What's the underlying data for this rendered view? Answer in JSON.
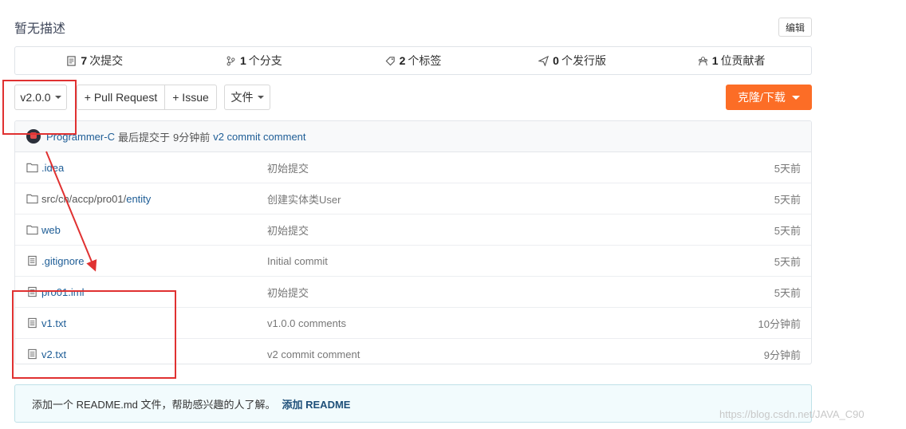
{
  "header": {
    "description": "暂无描述",
    "edit_label": "编辑"
  },
  "stats": [
    {
      "icon": "commit-icon",
      "count": "7",
      "label": "次提交"
    },
    {
      "icon": "branch-icon",
      "count": "1",
      "label": "个分支"
    },
    {
      "icon": "tag-icon",
      "count": "2",
      "label": "个标签"
    },
    {
      "icon": "release-icon",
      "count": "0",
      "label": "个发行版"
    },
    {
      "icon": "contributors-icon",
      "count": "1",
      "label": "位贡献者"
    }
  ],
  "toolbar": {
    "branch": "v2.0.0",
    "pull_request": "+ Pull Request",
    "issue": "+ Issue",
    "file_menu": "文件",
    "clone": "克隆/下载"
  },
  "last_commit": {
    "author": "Programmer-C",
    "action": "最后提交于",
    "time": "9分钟前",
    "message": "v2 commit comment"
  },
  "files": [
    {
      "type": "folder",
      "name_prefix": "",
      "name": ".idea",
      "message": "初始提交",
      "time": "5天前"
    },
    {
      "type": "folder",
      "name_prefix": "src/cn/accp/pro01/",
      "name": "entity",
      "message": "创建实体类User",
      "time": "5天前"
    },
    {
      "type": "folder",
      "name_prefix": "",
      "name": "web",
      "message": "初始提交",
      "time": "5天前"
    },
    {
      "type": "file",
      "name_prefix": "",
      "name": ".gitignore",
      "message": "Initial commit",
      "time": "5天前"
    },
    {
      "type": "file",
      "name_prefix": "",
      "name": "pro01.iml",
      "message": "初始提交",
      "time": "5天前"
    },
    {
      "type": "file",
      "name_prefix": "",
      "name": "v1.txt",
      "message": "v1.0.0 comments",
      "time": "10分钟前"
    },
    {
      "type": "file",
      "name_prefix": "",
      "name": "v2.txt",
      "message": "v2 commit comment",
      "time": "9分钟前"
    }
  ],
  "readme": {
    "text": "添加一个 README.md 文件，帮助感兴趣的人了解。",
    "link": "添加 README"
  },
  "watermark": "https://blog.csdn.net/JAVA_C90",
  "colors": {
    "accent": "#fc6d26",
    "link": "#1e5d96",
    "annotation_red": "#e03131"
  }
}
